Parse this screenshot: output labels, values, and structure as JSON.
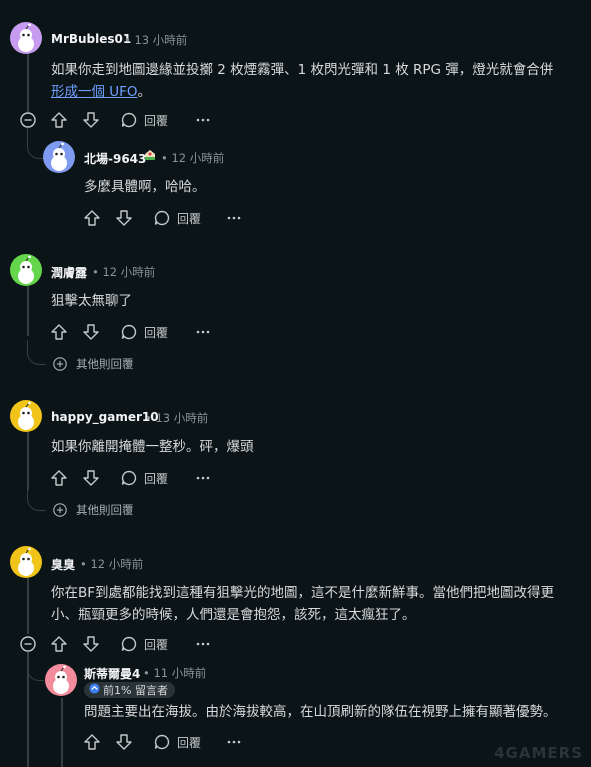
{
  "ui": {
    "reply_label": "回覆",
    "more_replies_label": "其他則回覆"
  },
  "comments": [
    {
      "user": "MrBubles01",
      "time": "13 小時前",
      "text_main": "如果你走到地圖邊緣並投擲 2 枚煙霧彈、1 枚閃光彈和 1 枚 RPG 彈，燈光就會合併",
      "text_link": "形成一個 UFO",
      "text_tail": "。",
      "avatar_color": "#c79cf0"
    },
    {
      "user": "北場-9643",
      "time": "12 小時前",
      "text": "多麼具體啊，哈哈。",
      "avatar_color": "#7e9bef"
    },
    {
      "user": "潤膚露",
      "time": "12 小時前",
      "text": "狙擊太無聊了",
      "avatar_color": "#63d64b"
    },
    {
      "user": "happy_gamer10",
      "time": "13 小時前",
      "text": "如果你離開掩體一整秒。砰，爆頭",
      "avatar_color": "#f0c419"
    },
    {
      "user": "臭臭",
      "time": "12 小時前",
      "text_line1": "你在BF到處都能找到這種有狙擊光的地圖，這不是什麼新鮮事。當他們把地圖改得更",
      "text_line2": "小、瓶頸更多的時候，人們還是會抱怨，該死，這太瘋狂了。",
      "avatar_color": "#f0c419"
    },
    {
      "user": "斯蒂爾曼4",
      "time": "11 小時前",
      "badge": "前1% 留言者",
      "text": "問題主要出在海拔。由於海拔較高，在山頂刷新的隊伍在視野上擁有顯著優勢。",
      "avatar_color": "#f28b9c"
    }
  ],
  "watermark": "4GAMERS"
}
